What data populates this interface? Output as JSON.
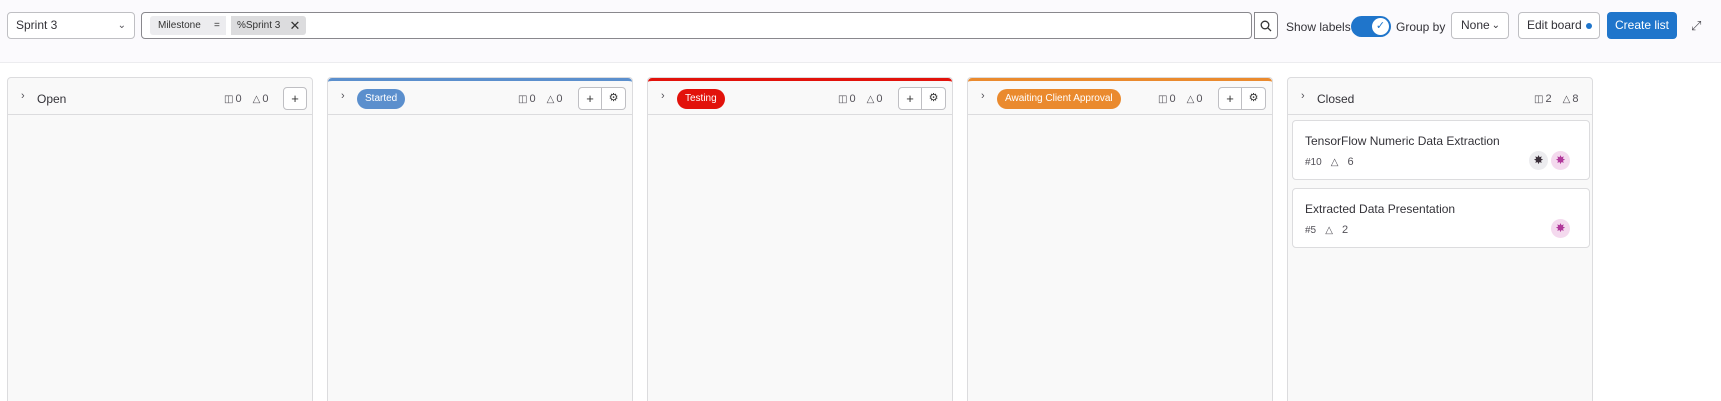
{
  "toolbar": {
    "milestone_select": "Sprint 3",
    "filter": {
      "key": "Milestone",
      "operator": "=",
      "value": "%Sprint 3"
    },
    "show_labels": "Show labels",
    "show_labels_on": true,
    "group_by": "Group by",
    "group_by_value": "None",
    "edit_board": "Edit board",
    "create_list": "Create list"
  },
  "lists": [
    {
      "title": "Open",
      "type": "plain",
      "issues": "0",
      "weight": "0"
    },
    {
      "title": "Started",
      "type": "label",
      "color": "#5b8fcd",
      "issues": "0",
      "weight": "0"
    },
    {
      "title": "Testing",
      "type": "label",
      "color": "#e2120b",
      "issues": "0",
      "weight": "0"
    },
    {
      "title": "Awaiting Client Approval",
      "type": "label",
      "color": "#ea8a2e",
      "issues": "0",
      "weight": "0"
    },
    {
      "title": "Closed",
      "type": "plain",
      "issues": "2",
      "weight": "8"
    }
  ],
  "cards": [
    {
      "title": "TensorFlow Numeric Data Extraction",
      "iid": "#10",
      "weight": "6"
    },
    {
      "title": "Extracted Data Presentation",
      "iid": "#5",
      "weight": "2"
    }
  ],
  "icons": {
    "chevron": "chevron-right-icon",
    "issues": "issues-icon",
    "weight": "weight-icon",
    "plus": "plus-icon",
    "settings": "gear-icon"
  }
}
